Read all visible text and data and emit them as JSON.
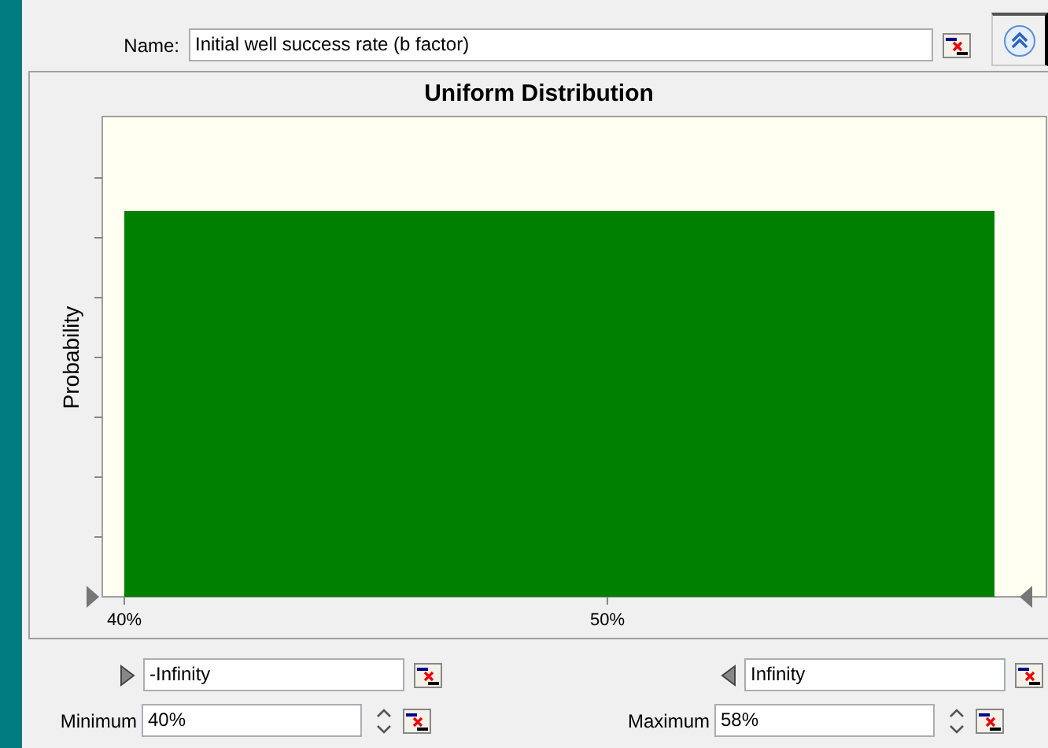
{
  "name_field": {
    "label": "Name:",
    "value": "Initial well success rate (b factor)"
  },
  "chart": {
    "title": "Uniform Distribution",
    "ylabel": "Probability",
    "xtick_labels": [
      "40%",
      "50%"
    ]
  },
  "bounds": [
    {
      "value": "-Infinity",
      "kind": "lower"
    },
    {
      "value": "Infinity",
      "kind": "upper"
    }
  ],
  "params": [
    {
      "label": "Minimum",
      "value": "40%"
    },
    {
      "label": "Maximum",
      "value": "58%"
    }
  ]
}
